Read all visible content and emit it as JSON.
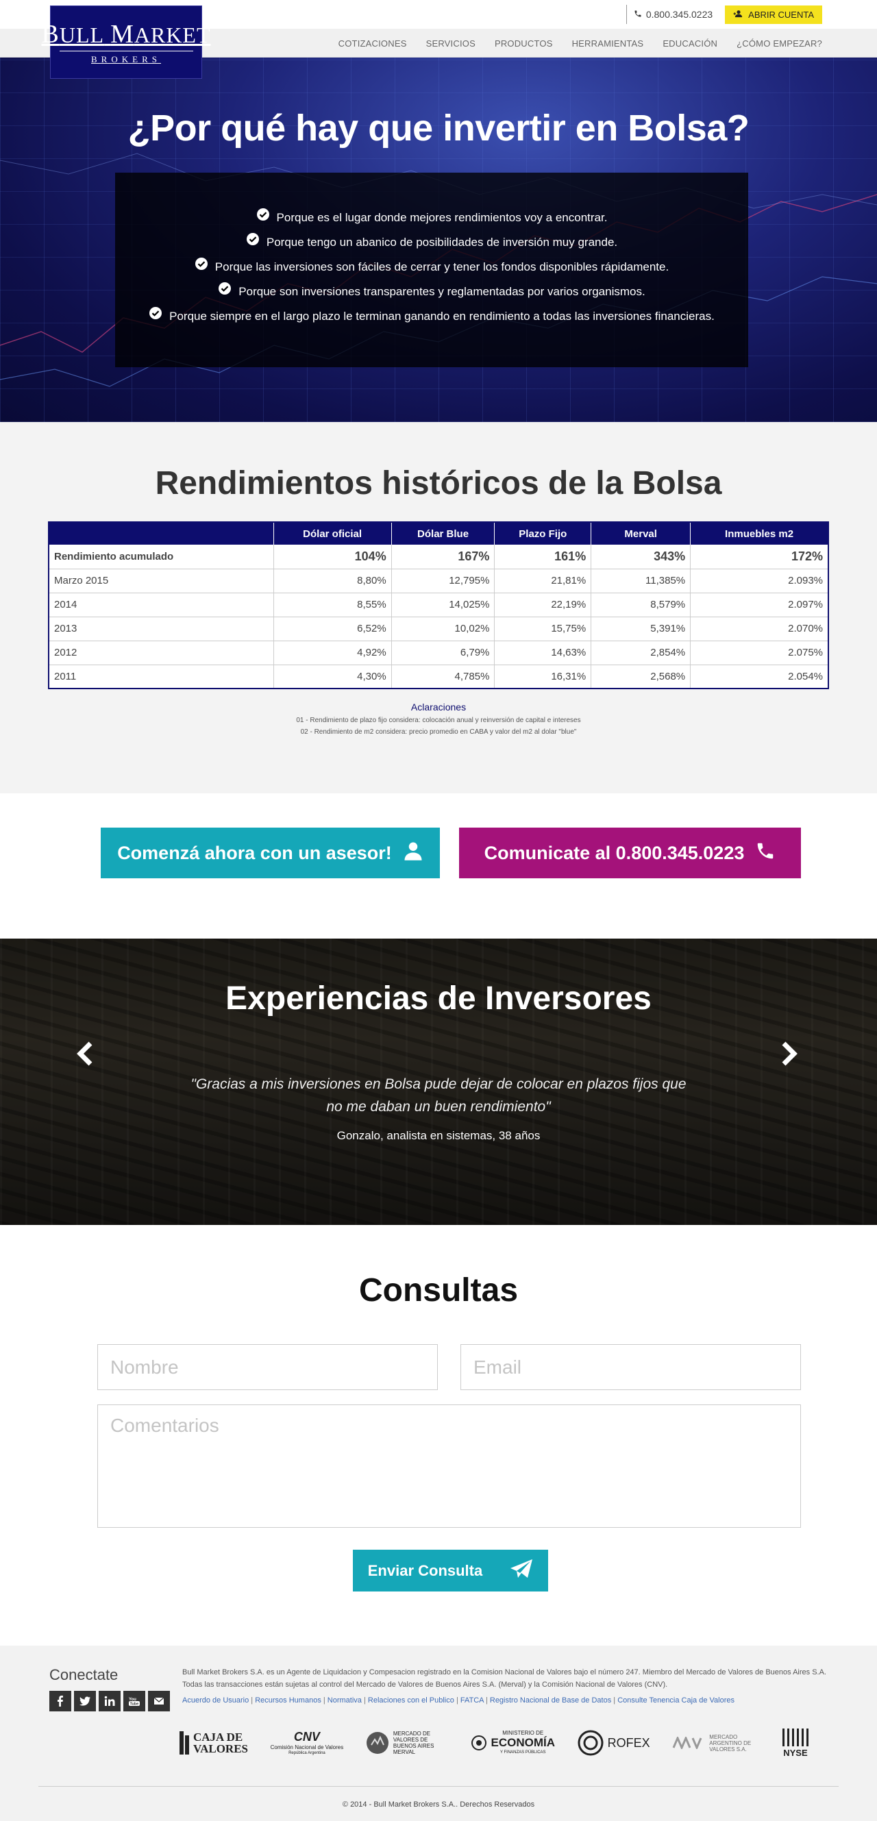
{
  "header": {
    "logo_line1": "BULL MARKET",
    "logo_line1_b": "B",
    "logo_line1_rest_a": "ULL",
    "logo_line1_m": "M",
    "logo_line1_rest_b": "ARKET",
    "logo_line2": "BROKERS",
    "phone": "0.800.345.0223",
    "open_account": "ABRIR CUENTA",
    "nav": [
      "COTIZACIONES",
      "SERVICIOS",
      "PRODUCTOS",
      "HERRAMIENTAS",
      "EDUCACIÓN",
      "¿CÓMO EMPEZAR?"
    ]
  },
  "hero": {
    "title": "¿Por qué hay que invertir en Bolsa?",
    "reasons": [
      "Porque es el lugar donde mejores rendimientos voy a encontrar.",
      "Porque tengo un abanico de posibilidades de inversión muy grande.",
      "Porque las inversiones son fáciles de cerrar y tener los fondos disponibles rápidamente.",
      "Porque son inversiones transparentes y reglamentadas por varios organismos.",
      "Porque siempre en el largo plazo le terminan ganando en rendimiento a todas las inversiones financieras."
    ]
  },
  "rendimientos": {
    "title": "Rendimientos históricos de la Bolsa",
    "columns": [
      "",
      "Dólar oficial",
      "Dólar Blue",
      "Plazo Fijo",
      "Merval",
      "Inmuebles m2"
    ],
    "acumulado": {
      "label": "Rendimiento acumulado",
      "values": [
        "104%",
        "167%",
        "161%",
        "343%",
        "172%"
      ]
    },
    "rows": [
      [
        "Marzo 2015",
        "8,80%",
        "12,795%",
        "21,81%",
        "11,385%",
        "2.093%"
      ],
      [
        "2014",
        "8,55%",
        "14,025%",
        "22,19%",
        "8,579%",
        "2.097%"
      ],
      [
        "2013",
        "6,52%",
        "10,02%",
        "15,75%",
        "5,391%",
        "2.070%"
      ],
      [
        "2012",
        "4,92%",
        "6,79%",
        "14,63%",
        "2,854%",
        "2.075%"
      ],
      [
        "2011",
        "4,30%",
        "4,785%",
        "16,31%",
        "2,568%",
        "2.054%"
      ]
    ],
    "aclaraciones_title": "Aclaraciones",
    "notes": [
      "01 - Rendimiento de plazo fijo considera: colocación anual y reinversión de capital e intereses",
      "02 - Rendimiento de m2 considera: precio promedio en CABA y valor del m2 al dolar \"blue\""
    ],
    "colors": {
      "header": "#0d0d6e",
      "negative": "#e0002a",
      "positive": "#4bb04a"
    }
  },
  "cta": {
    "asesor": "Comenzá ahora con un asesor!",
    "telefono": "Comunicate al 0.800.345.0223",
    "colors": {
      "asesor": "#15a7b8",
      "telefono": "#a4127a"
    }
  },
  "experiencias": {
    "title": "Experiencias de Inversores",
    "quote": "\"Gracias a mis inversiones en Bolsa pude dejar de  colocar en plazos fijos que no me daban un buen rendimiento\"",
    "author": "Gonzalo, analista en sistemas, 38 años"
  },
  "consultas": {
    "title": "Consultas",
    "nombre_placeholder": "Nombre",
    "email_placeholder": "Email",
    "comentarios_placeholder": "Comentarios",
    "submit": "Enviar Consulta"
  },
  "footer": {
    "conectate": "Conectate",
    "legal": "Bull Market Brokers S.A. es un Agente de Liquidacion y Compesacion registrado en la Comision Nacional de Valores bajo el número 247. Miembro del Mercado de Valores de Buenos Aires S.A. Todas las transacciones están sujetas al control del Mercado de Valores de Buenos Aires S.A. (Merval) y la Comisión Nacional de Valores (CNV).",
    "links": [
      "Acuerdo de Usuario",
      "Recursos Humanos",
      "Normativa",
      "Relaciones con el Publico",
      "FATCA",
      "Registro Nacional de Base de Datos",
      "Consulte Tenencia Caja de Valores"
    ],
    "logos": {
      "caja_1": "CAJA DE",
      "caja_2": "VALORES",
      "cnv_1": "CNV",
      "cnv_2": "Comisión Nacional de Valores",
      "cnv_3": "República Argentina",
      "merval": "MERCADO DE VALORES DE BUENOS AIRES MERVAL",
      "min_1": "MINISTERIO DE",
      "min_2": "ECONOMÍA",
      "min_3": "Y FINANZAS PÚBLICAS",
      "rofex": "ROFEX",
      "mav": "MERCADO ARGENTINO DE VALORES S.A.",
      "nyse": "NYSE"
    },
    "copyright": "© 2014 - Bull Market Brokers S.A.. Derechos Reservados"
  }
}
